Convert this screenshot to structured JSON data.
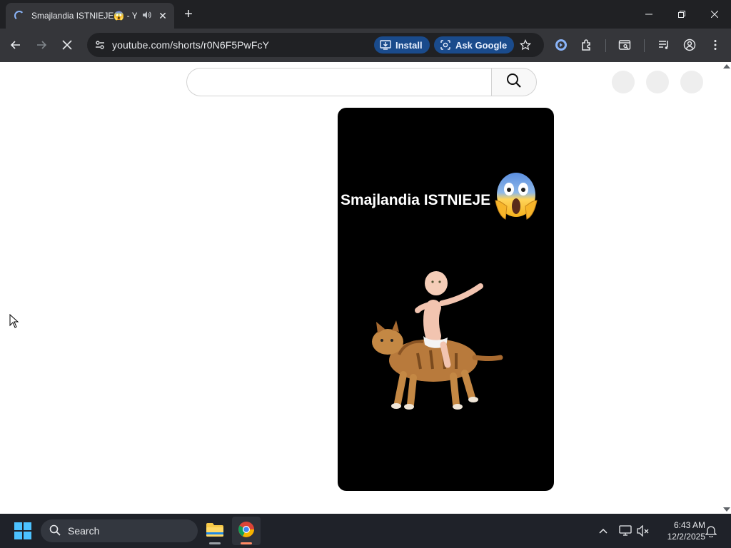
{
  "browser": {
    "tab": {
      "title": "Smajlandia ISTNIEJE😱 - Yo",
      "audio_icon": "speaker-icon",
      "close_label": "✕"
    },
    "new_tab_label": "+",
    "window_controls": [
      "minimize",
      "restore",
      "close"
    ],
    "address_bar": {
      "url": "youtube.com/shorts/r0N6F5PwFcY"
    },
    "chips": {
      "install_label": "Install",
      "ask_google_label": "Ask Google"
    },
    "colors": {
      "tabstrip": "#202124",
      "toolbar": "#35363a",
      "chip": "#1a4b8c"
    }
  },
  "page": {
    "search": {
      "value": "",
      "button_icon": "search-icon"
    },
    "short": {
      "overlay_text": "Smajlandia ISTNIEJE",
      "emoji_icon": "screaming-face-emoji",
      "background": "#000000"
    }
  },
  "taskbar": {
    "search_label": "Search",
    "apps": [
      "file-explorer",
      "chrome"
    ],
    "time": "6:43 AM",
    "date": "12/2/2025"
  }
}
